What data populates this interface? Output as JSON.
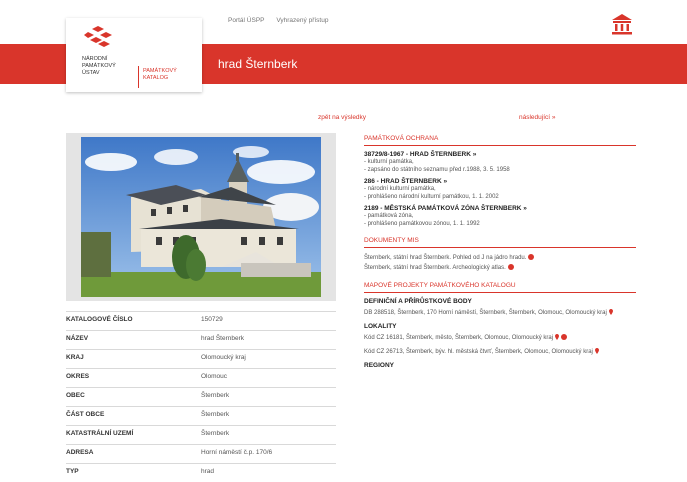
{
  "header": {
    "nav": [
      "Portál ÚSPP",
      "Vyhrazený přístup"
    ],
    "logo_lines": [
      "NÁRODNÍ",
      "PAMÁTKOVÝ",
      "ÚSTAV"
    ],
    "logo_sub": [
      "PAMÁTKOVÝ",
      "KATALOG"
    ],
    "title": "hrad Šternberk",
    "accent": "#d9352b"
  },
  "pager": {
    "back": "zpět na výsledky",
    "next": "následující »"
  },
  "properties": [
    {
      "label": "KATALOGOVÉ ČÍSLO",
      "value": "150729"
    },
    {
      "label": "NÁZEV",
      "value": "hrad Šternberk"
    },
    {
      "label": "KRAJ",
      "value": "Olomoucký kraj"
    },
    {
      "label": "OKRES",
      "value": "Olomouc"
    },
    {
      "label": "OBEC",
      "value": "Šternberk"
    },
    {
      "label": "ČÁST OBCE",
      "value": "Šternberk"
    },
    {
      "label": "KATASTRÁLNÍ UZEMÍ",
      "value": "Šternberk"
    },
    {
      "label": "ADRESA",
      "value": "Horní náměstí č.p. 170/6"
    },
    {
      "label": "TYP",
      "value": "hrad"
    }
  ],
  "protection": {
    "heading": "PAMÁTKOVÁ OCHRANA",
    "entries": [
      {
        "title": "38729/8-1967 - HRAD ŠTERNBERK »",
        "lines": [
          "- kulturní památka,",
          "- zapsáno do státního seznamu před r.1988, 3. 5. 1958"
        ]
      },
      {
        "title": "286 - HRAD ŠTERNBERK »",
        "lines": [
          "- národní kulturní památka,",
          "- prohlášeno národní kulturní památkou, 1. 1. 2002"
        ]
      },
      {
        "title": "2189 - MĚSTSKÁ PAMÁTKOVÁ ZÓNA ŠTERNBERK »",
        "lines": [
          "- památková zóna,",
          "- prohlášeno památkovou zónou, 1. 1. 1992"
        ]
      }
    ]
  },
  "documents": {
    "heading": "DOKUMENTY MIS",
    "items": [
      "Šternberk, státní hrad Šternberk. Pohled od J na jádro hradu.",
      "Šternberk, státní hrad Šternberk. Archeologický atlas."
    ]
  },
  "projects": {
    "heading": "MAPOVÉ PROJEKTY PAMÁTKOVÉHO KATALOGU",
    "def_heading": "DEFINIČNÍ A PŘÍRŮSTKOVÉ BODY",
    "def_text": "DB 288518, Šternberk, 170 Horní náměstí, Šternberk, Šternberk, Olomouc, Olomoucký kraj",
    "loc_heading": "LOKALITY",
    "loc1": "Kód CZ 16181, Šternberk, město, Šternberk, Olomouc, Olomoucký kraj",
    "loc2": "Kód CZ 26713, Šternberk, býv. hl. městská čtvrť, Šternberk, Olomouc, Olomoucký kraj",
    "reg_heading": "REGIONY"
  }
}
